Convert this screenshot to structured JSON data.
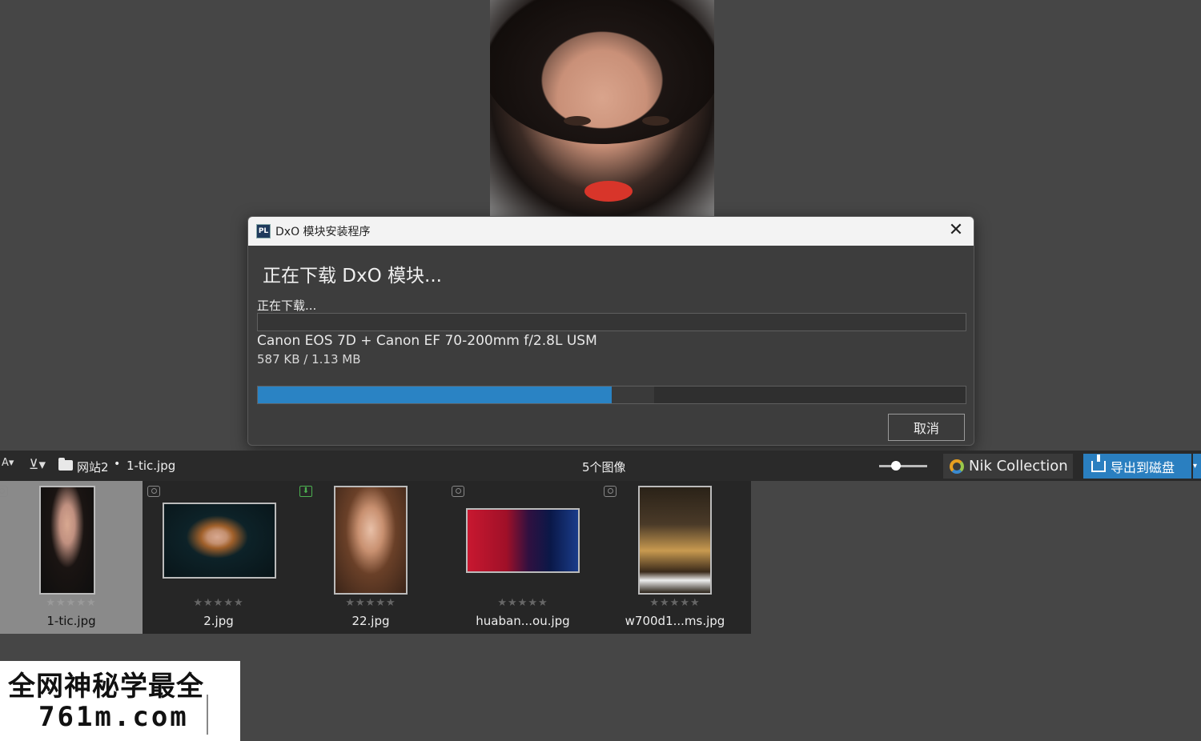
{
  "dialog": {
    "title": "DxO 模块安装程序",
    "app_icon": "PL",
    "heading": "正在下载 DxO 模块...",
    "status": "正在下载...",
    "module_name": "Canon EOS 7D + Canon EF 70-200mm f/2.8L USM",
    "size_text": "587 KB / 1.13 MB",
    "progress": 0.5,
    "cancel_label": "取消",
    "close_icon": "close-icon"
  },
  "toolbar": {
    "sort_icon": "A↓Z",
    "breadcrumb_folder": "网站2",
    "breadcrumb_sep": "•",
    "breadcrumb_file": "1-tic.jpg",
    "image_count": "5个图像",
    "zoom_level": 0.25,
    "nik_label": "Nik Collection",
    "export_label": "导出到磁盘"
  },
  "filmstrip": {
    "items": [
      {
        "name": "1-tic.jpg",
        "rating": "★★★★★",
        "selected": true
      },
      {
        "name": "2.jpg",
        "rating": "★★★★★"
      },
      {
        "name": "22.jpg",
        "rating": "★★★★★"
      },
      {
        "name": "huaban...ou.jpg",
        "rating": "★★★★★"
      },
      {
        "name": "w700d1...ms.jpg",
        "rating": "★★★★★"
      }
    ]
  },
  "watermark": {
    "line1": "全网神秘学最全",
    "line2": "761m.com"
  },
  "colors": {
    "accent": "#2a83c4",
    "background": "#464646",
    "toolbar": "#2a2a2a"
  }
}
